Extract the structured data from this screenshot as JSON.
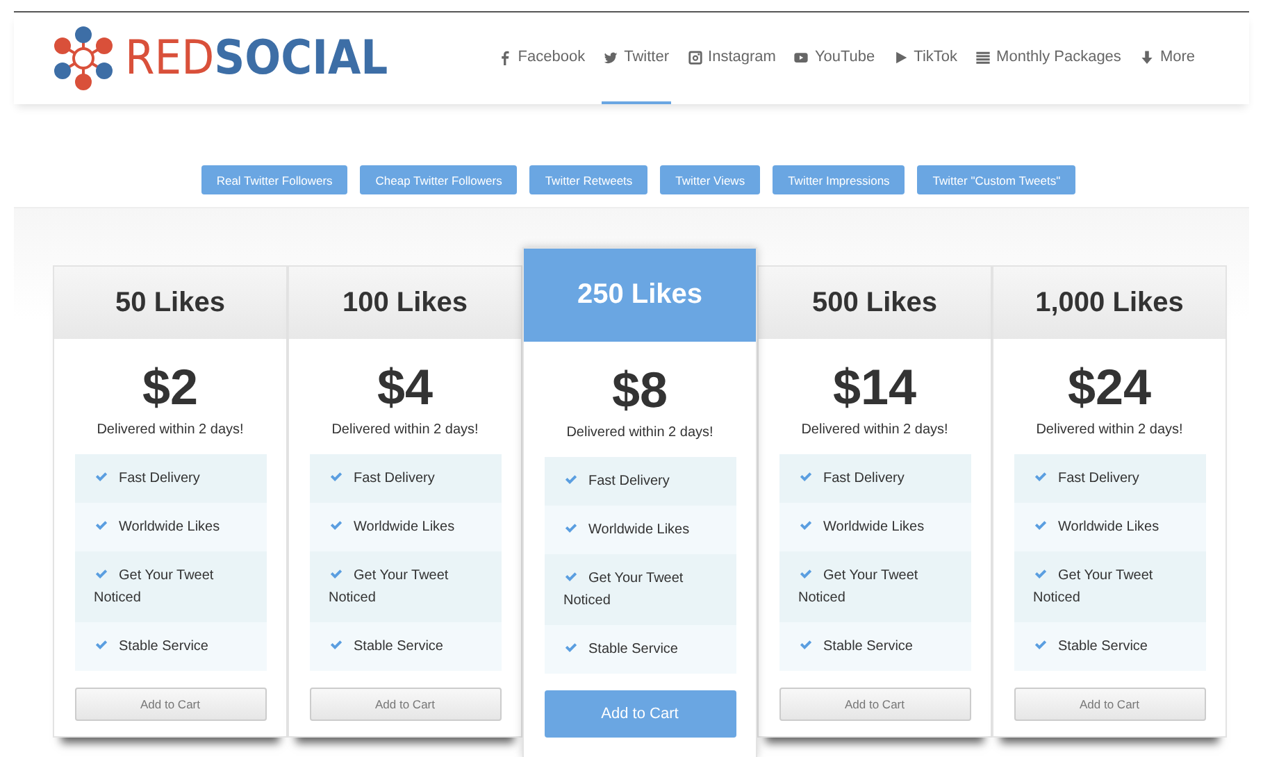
{
  "logo": {
    "text": "RED**SOCIAL**"
  },
  "nav": [
    {
      "label": "Facebook",
      "kind": "facebook",
      "selected": false
    },
    {
      "label": "Twitter",
      "kind": "twitter",
      "selected": true
    },
    {
      "label": "Instagram",
      "kind": "instagram",
      "selected": false
    },
    {
      "label": "YouTube",
      "kind": "youtube",
      "selected": false
    },
    {
      "label": "TikTok",
      "kind": "play",
      "selected": false
    },
    {
      "label": "Monthly Packages",
      "kind": "list",
      "selected": false
    },
    {
      "label": "More",
      "kind": "down",
      "selected": false
    }
  ],
  "service_tabs": [
    "Real Twitter Followers",
    "Cheap Twitter Followers",
    "Twitter Retweets",
    "Twitter Views",
    "Twitter Impressions",
    "Twitter \"Custom Tweets\""
  ],
  "plans": [
    {
      "title": "50 Likes",
      "price": "$2",
      "delivery": "Delivered within 2 days!",
      "featured": false,
      "features": [
        "Fast Delivery",
        "Worldwide Likes",
        "Get Your Tweet Noticed",
        "Stable Service"
      ],
      "button": "Add to Cart"
    },
    {
      "title": "100 Likes",
      "price": "$4",
      "delivery": "Delivered within 2 days!",
      "featured": false,
      "features": [
        "Fast Delivery",
        "Worldwide Likes",
        "Get Your Tweet Noticed",
        "Stable Service"
      ],
      "button": "Add to Cart"
    },
    {
      "title": "250 Likes",
      "price": "$8",
      "delivery": "Delivered within 2 days!",
      "featured": true,
      "features": [
        "Fast Delivery",
        "Worldwide Likes",
        "Get Your Tweet Noticed",
        "Stable Service"
      ],
      "button": "Add to Cart"
    },
    {
      "title": "500 Likes",
      "price": "$14",
      "delivery": "Delivered within 2 days!",
      "featured": false,
      "features": [
        "Fast Delivery",
        "Worldwide Likes",
        "Get Your Tweet Noticed",
        "Stable Service"
      ],
      "button": "Add to Cart"
    },
    {
      "title": "1,000 Likes",
      "price": "$24",
      "delivery": "Delivered within 2 days!",
      "featured": false,
      "features": [
        "Fast Delivery",
        "Worldwide Likes",
        "Get Your Tweet Noticed",
        "Stable Service"
      ],
      "button": "Add to Cart"
    }
  ]
}
